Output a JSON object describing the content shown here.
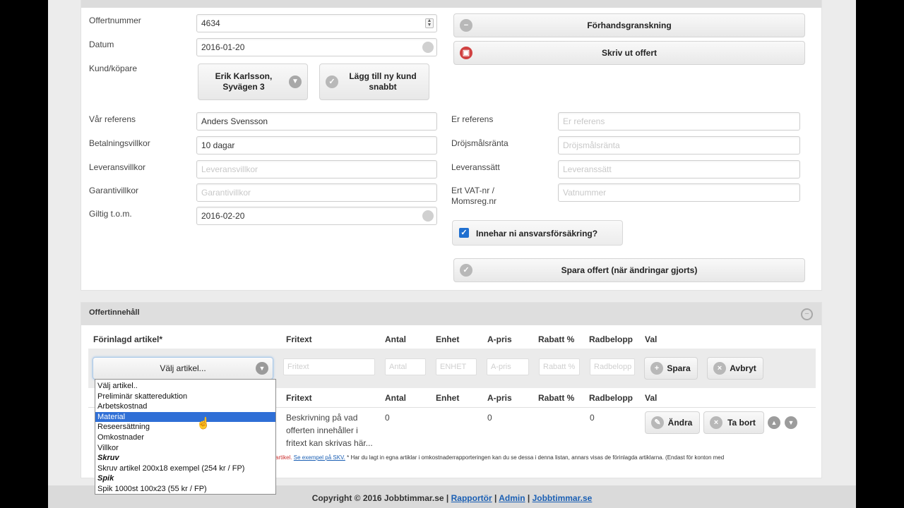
{
  "form": {
    "offertnummer": {
      "label": "Offertnummer",
      "value": "4634"
    },
    "datum": {
      "label": "Datum",
      "value": "2016-01-20"
    },
    "kund": {
      "label": "Kund/köpare",
      "button": "Erik Karlsson, Syvägen 3",
      "add_button": "Lägg till ny kund snabbt"
    },
    "var_referens": {
      "label": "Vår referens",
      "value": "Anders Svensson"
    },
    "betalningsvillkor": {
      "label": "Betalningsvillkor",
      "value": "10 dagar"
    },
    "leveransvillkor": {
      "label": "Leveransvillkor",
      "placeholder": "Leveransvillkor"
    },
    "garantivillkor": {
      "label": "Garantivillkor",
      "placeholder": "Garantivillkor"
    },
    "giltig": {
      "label": "Giltig t.o.m.",
      "value": "2016-02-20"
    },
    "er_referens": {
      "label": "Er referens",
      "placeholder": "Er referens"
    },
    "drojsmalsranta": {
      "label": "Dröjsmålsränta",
      "placeholder": "Dröjsmålsränta"
    },
    "leveranssatt": {
      "label": "Leveranssätt",
      "placeholder": "Leveranssätt"
    },
    "vat": {
      "label_line1": "Ert VAT-nr /",
      "label_line2": "Momsreg.nr",
      "placeholder": "Vatnummer"
    },
    "insurance_label": "Innehar ni ansvarsförsäkring?",
    "insurance_checked": true,
    "preview_button": "Förhandsgranskning",
    "print_button": "Skriv ut offert",
    "save_button": "Spara offert (när ändringar gjorts)"
  },
  "content": {
    "title": "Offertinnehåll",
    "headers": {
      "article": "Förinlagd artikel*",
      "fritext": "Fritext",
      "antal": "Antal",
      "enhet": "Enhet",
      "apris": "A-pris",
      "rabatt": "Rabatt %",
      "radbelopp": "Radbelopp",
      "val": "Val"
    },
    "entry": {
      "select_label": "Välj artikel...",
      "fritext_ph": "Fritext",
      "antal_ph": "Antal",
      "enhet_ph": "ENHET",
      "apris_ph": "A-pris",
      "rabatt_ph": "Rabatt %",
      "radbelopp_ph": "Radbelopp",
      "save": "Spara",
      "cancel": "Avbryt"
    },
    "row": {
      "fritext_l1": "Beskrivning på vad",
      "fritext_l2": "offerten innehåller i",
      "fritext_l3": "fritext kan skrivas här...",
      "antal": "0",
      "apris": "0",
      "radbelopp": "0",
      "edit": "Ändra",
      "delete": "Ta bort"
    },
    "dropdown": [
      {
        "label": "Välj artikel..",
        "type": "item"
      },
      {
        "label": "Preliminär skattereduktion",
        "type": "item"
      },
      {
        "label": "Arbetskostnad",
        "type": "item"
      },
      {
        "label": "Material",
        "type": "selected"
      },
      {
        "label": "Reseersättning",
        "type": "item"
      },
      {
        "label": "Omkostnader",
        "type": "item"
      },
      {
        "label": "Villkor",
        "type": "item"
      },
      {
        "label": "Skruv",
        "type": "group"
      },
      {
        "label": "Skruv artikel 200x18 exempel (254 kr / FP)",
        "type": "item"
      },
      {
        "label": "Spik",
        "type": "group"
      },
      {
        "label": "Spik 1000st 100x23 (55 kr / FP)",
        "type": "item"
      }
    ],
    "note_prefix": "artikel.",
    "note_link": "Se exempel på SKV.",
    "note_text": " * Har du lagt in egna artiklar i omkostnaderrapporteringen kan du se dessa i denna listan, annars visas de förinlagda artiklarna. (Endast för konton med"
  },
  "footer": {
    "copyright": "Copyright © 2016 Jobbtimmar.se",
    "sep": " | ",
    "link1": "Rapportör",
    "link2": "Admin",
    "link3": "Jobbtimmar.se"
  }
}
